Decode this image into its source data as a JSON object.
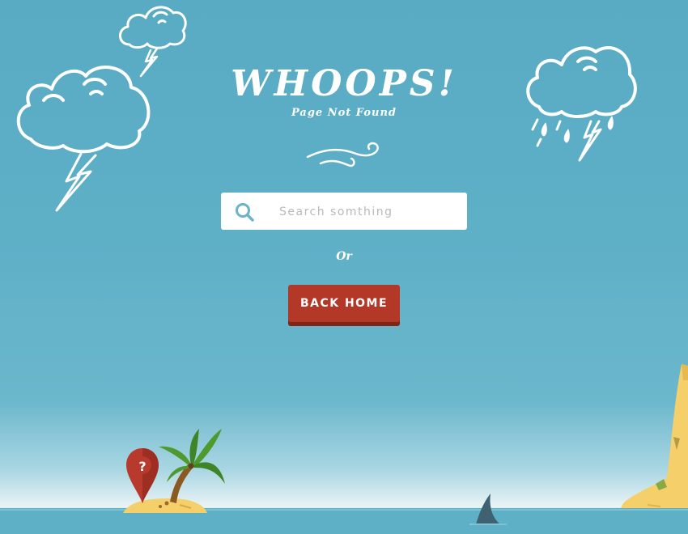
{
  "heading": {
    "title": "WHOOPS!",
    "subtitle": "Page Not Found"
  },
  "search": {
    "placeholder": "Search somthing",
    "value": ""
  },
  "separator_text": "Or",
  "back_home": {
    "label": "BACK HOME"
  },
  "colors": {
    "sky": "#58abc3",
    "button": "#b43827",
    "button_shadow": "#7f2417",
    "sand": "#f4cf6a",
    "palm_leaf": "#4f9a2f",
    "pin": "#b83a2d"
  },
  "icons": [
    "cloud-lightning-icon",
    "cloud-rain-icon",
    "search-icon",
    "swirl-ornament-icon",
    "location-pin-question-icon",
    "palm-tree-icon",
    "shark-fin-icon"
  ]
}
